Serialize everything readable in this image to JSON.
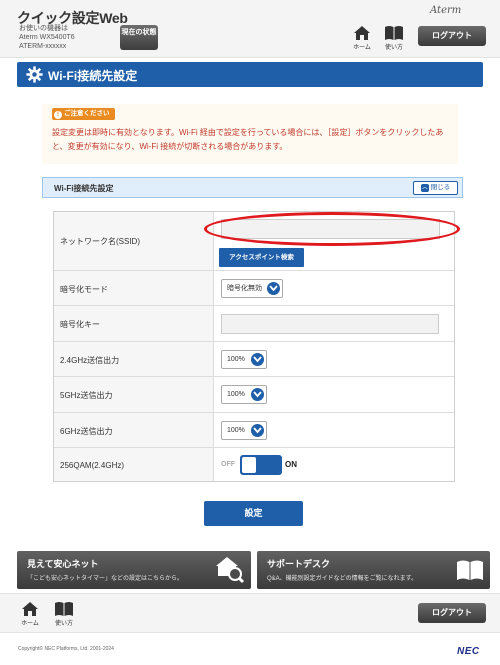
{
  "header": {
    "app_title": "クイック設定Web",
    "device_caption": "お使いの機器は",
    "device_model": "Aterm WX5400T6",
    "device_id": "ATERM-xxxxxx",
    "status_button": "現在の状態",
    "brand": "Aterm",
    "nav": {
      "home_label": "ホーム",
      "manual_label": "使い方"
    },
    "logout_label": "ログアウト"
  },
  "page": {
    "title": "Wi-Fi接続先設定"
  },
  "notice": {
    "badge": "ご注意ください",
    "text": "設定変更は即時に有効となります。Wi-Fi 経由で設定を行っている場合には、［設定］ボタンをクリックしたあと、変更が有効になり、Wi-Fi 接続が切断される場合があります。"
  },
  "section": {
    "title": "Wi-Fi接続先設定",
    "collapse_label": "閉じる"
  },
  "form": {
    "ssid": {
      "label": "ネットワーク名(SSID)",
      "value": "",
      "ap_search_label": "アクセスポイント検索"
    },
    "encryption_mode": {
      "label": "暗号化モード",
      "value": "暗号化無効"
    },
    "encryption_key": {
      "label": "暗号化キー",
      "value": ""
    },
    "power_24": {
      "label": "2.4GHz送信出力",
      "value": "100%"
    },
    "power_5": {
      "label": "5GHz送信出力",
      "value": "100%"
    },
    "power_6": {
      "label": "6GHz送信出力",
      "value": "100%"
    },
    "qam256": {
      "label": "256QAM(2.4GHz)",
      "off_label": "OFF",
      "on_label": "ON",
      "state": "on"
    }
  },
  "submit_label": "設定",
  "promos": [
    {
      "title": "見えて安心ネット",
      "desc": "「こども安心ネットタイマー」などの設定はこちらから。"
    },
    {
      "title": "サポートデスク",
      "desc": "Q&A、機能別設定ガイドなどの情報をご覧になれます。"
    }
  ],
  "footer": {
    "home_label": "ホーム",
    "manual_label": "使い方",
    "logout_label": "ログアウト",
    "copyright": "Copyright© NEC Platforms, Ltd. 2001-2024",
    "logo": "NEC"
  },
  "colors": {
    "primary": "#1f5ea8",
    "warning": "#e98b21",
    "alert_text": "#c0392b",
    "highlight": "#e0191e"
  }
}
